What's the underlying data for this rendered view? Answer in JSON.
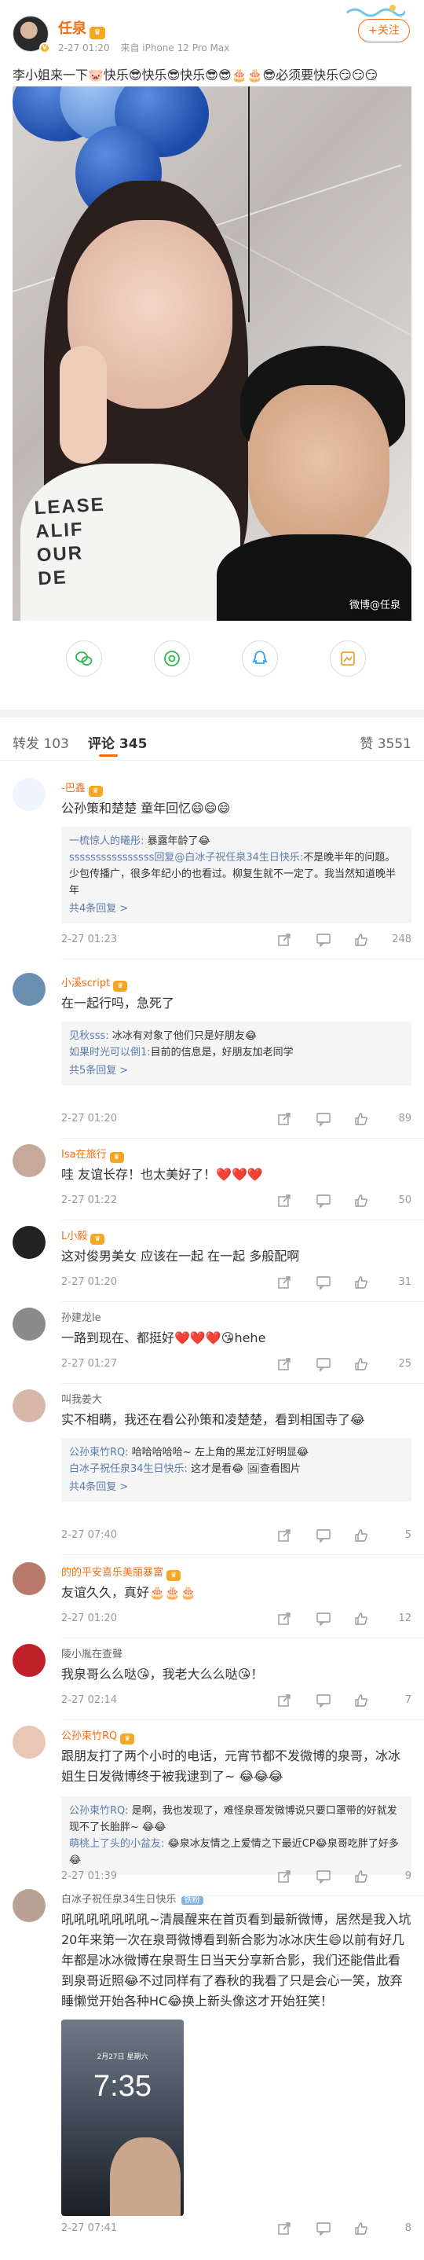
{
  "post": {
    "author": "任泉",
    "time": "2-27 01:20",
    "device": "来自 iPhone 12 Pro Max",
    "follow_label": "+关注",
    "text": "李小姐来一下🐷快乐😎快乐😎快乐😎😎🎂🎂😎必须要快乐😏😏😏",
    "watermark": "微博@任泉",
    "shirt_text": "LEASE\nALIF\nOUR\nDE"
  },
  "share_icons": [
    "wechat-icon",
    "moments-icon",
    "qq-icon",
    "save-image-icon"
  ],
  "tabs": {
    "reposts": "转发 103",
    "comments": "评论 345",
    "likes": "赞 3551"
  },
  "comments": [
    {
      "name": "-巴鑫",
      "crown": true,
      "text": "公孙策和楚楚 童年回忆😄😄😄",
      "replies": [
        {
          "name": "一梳惊人的曦彤:",
          "text": " 暴露年龄了😂"
        },
        {
          "name": "ssssssssssssssss回复@白冰子祝任泉34生日快乐:",
          "text": "不是晚半年的问题。少包传播广，很多年纪小的也看过。柳复生就不一定了。我当然知道晚半年"
        }
      ],
      "more": "共4条回复 >",
      "time": "2-27 01:23",
      "likes": "248"
    },
    {
      "name": "小溪script",
      "crown": true,
      "text": "在一起行吗，急死了",
      "replies": [
        {
          "name": "见秋sss:",
          "text": " 冰冰有对象了他们只是好朋友😂"
        },
        {
          "name": "如果时光可以倒1:",
          "text": "目前的信息是，好朋友加老同学"
        }
      ],
      "more": "共5条回复 >",
      "time": "2-27 01:20",
      "likes": "89"
    },
    {
      "name": "Isa在旅行",
      "crown": true,
      "text": "哇 友谊长存！也太美好了！❤️❤️❤️",
      "time": "2-27 01:22",
      "likes": "50"
    },
    {
      "name": "L小毅",
      "crown": true,
      "text": "这对俊男美女 应该在一起 在一起 多般配啊",
      "time": "2-27 01:20",
      "likes": "31"
    },
    {
      "name": "孙建龙le",
      "crown": false,
      "text": "一路到现在、都挺好❤️❤️❤️😘hehe",
      "time": "2-27 01:27",
      "likes": "25"
    },
    {
      "name": "叫我姜大",
      "crown": false,
      "text": "实不相瞒，我还在看公孙策和凌楚楚，看到相国寺了😂",
      "replies": [
        {
          "name": "公孙束竹RQ:",
          "text": " 哈哈哈哈哈~ 左上角的黑龙江好明显😂"
        },
        {
          "name": "白冰子祝任泉34生日快乐:",
          "text": " 这才是看😂 🖼查看图片"
        }
      ],
      "more": "共4条回复 >",
      "time": "2-27 07:40",
      "likes": "5"
    },
    {
      "name": "的的平安喜乐美丽暴富",
      "crown": true,
      "text": "友谊久久，真好🎂🎂🎂",
      "time": "2-27 01:20",
      "likes": "12"
    },
    {
      "name": "陵小胤在查聲",
      "crown": false,
      "text": "我泉哥么么哒😘，我老大么么哒😘！",
      "time": "2-27 02:14",
      "likes": "7"
    },
    {
      "name": "公孙束竹RQ",
      "crown": true,
      "text": "跟朋友打了两个小时的电话，元宵节都不发微博的泉哥，冰冰姐生日发微博终于被我逮到了~ 😂😂😂",
      "replies": [
        {
          "name": "公孙束竹RQ:",
          "text": " 是啊，我也发现了，难怪泉哥发微博说只要口罩带的好就发现不了长胎胖~ 😂😂"
        },
        {
          "name": "萌桃上了头的小盆友:",
          "text": " 😂泉冰友情之上爱情之下最近CP😂泉哥吃胖了好多😂"
        }
      ],
      "time": "2-27 01:39",
      "likes": "9"
    },
    {
      "name": "白冰子祝任泉34生日快乐",
      "crown": false,
      "badge": "铁粉",
      "text": "吼吼吼吼吼吼吼~清晨醒来在首页看到最新微博，居然是我入坑20年来第一次在泉哥微博看到新合影为冰冰庆生😄以前有好几年都是冰冰微博在泉哥生日当天分享新合影，我们还能借此看到泉哥近照😂不过同样有了春秋的我看了只是会心一笑，放弃睡懒觉开始各种HC😂换上新头像这才开始狂笑！",
      "phone_time": "7:35",
      "phone_date": "2月27日 星期六",
      "time": "2-27 07:41",
      "likes": "8"
    }
  ]
}
